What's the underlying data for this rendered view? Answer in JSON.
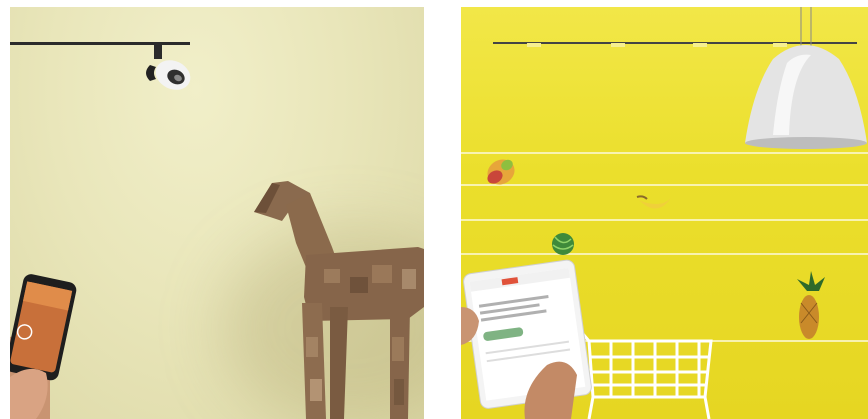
{
  "scene": {
    "left_panel": {
      "background": "#e9e6ba",
      "subjects": [
        "track-spotlight-icon",
        "wooden-horse-sculpture",
        "smartphone-in-hand"
      ]
    },
    "right_panel": {
      "background": "#ebdf2c",
      "subjects": [
        "pendant-lamp-icon",
        "mango-icon",
        "banana-icon",
        "watermelon-icon",
        "pineapple-icon",
        "tablet-in-hand",
        "shopping-cart-icon"
      ]
    },
    "colors": {
      "cream": "#e9e6ba",
      "yellow": "#ebdf2c",
      "wood": "#8a6a4e",
      "lamp_white": "#e7e7e7",
      "accent_red": "#e0523a",
      "accent_green": "#7fb383"
    }
  }
}
